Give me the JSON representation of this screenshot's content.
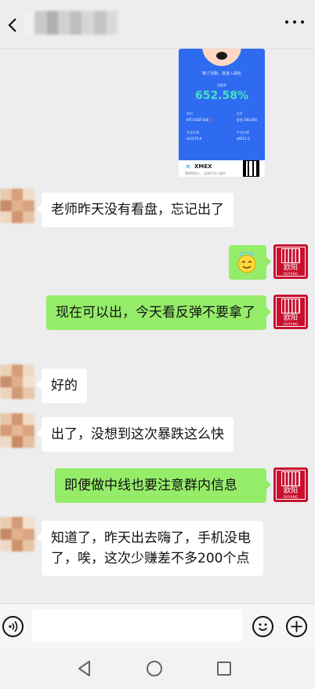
{
  "header": {
    "back_icon": "chevron-left-icon",
    "more_icon": "more-dots-icon"
  },
  "shared_image": {
    "caption": "赚了别跑，真金入袋包",
    "metric_label": "回报率",
    "metric_value": "652.58%",
    "contract_label": "合约",
    "contract_value": "BTC/USDT永续",
    "contract_tag": "多",
    "position_label": "杠杆",
    "position_value": "全仓 100.00X",
    "open_price_label": "开仓价格",
    "open_price_value": "$10175.9",
    "close_price_label": "平仓价格",
    "close_price_value": "$9511.0",
    "brand_name": "XMEX",
    "brand_sub": "邀请您加入，长按识别二维码"
  },
  "messages": [
    {
      "side": "left",
      "text": "老师昨天没有看盘，忘记出了"
    },
    {
      "side": "right",
      "text": "😇"
    },
    {
      "side": "right",
      "text": "现在可以出，今天看反弹不要拿了"
    },
    {
      "side": "left",
      "text": "好的"
    },
    {
      "side": "left",
      "text": "出了，没想到这次暴跌这么快"
    },
    {
      "side": "right",
      "text": "即便做中线也要注意群内信息"
    },
    {
      "side": "left",
      "text": "知道了，昨天出去嗨了，手机没电了，唉，这次少赚差不多200个点"
    }
  ],
  "self_avatar": {
    "text": "欧阳",
    "sub": "OUYANG"
  },
  "input_bar": {
    "value": "",
    "voice_icon": "voice-icon",
    "emoji_icon": "emoji-icon",
    "plus_icon": "plus-icon"
  },
  "navbar": {
    "back_icon": "nav-back-icon",
    "home_icon": "nav-home-icon",
    "recent_icon": "nav-recent-icon"
  },
  "colors": {
    "chat_bg": "#ededed",
    "green_bubble": "#95ec69",
    "card_blue": "#2f6bf0",
    "avatar_red": "#c8102e"
  }
}
